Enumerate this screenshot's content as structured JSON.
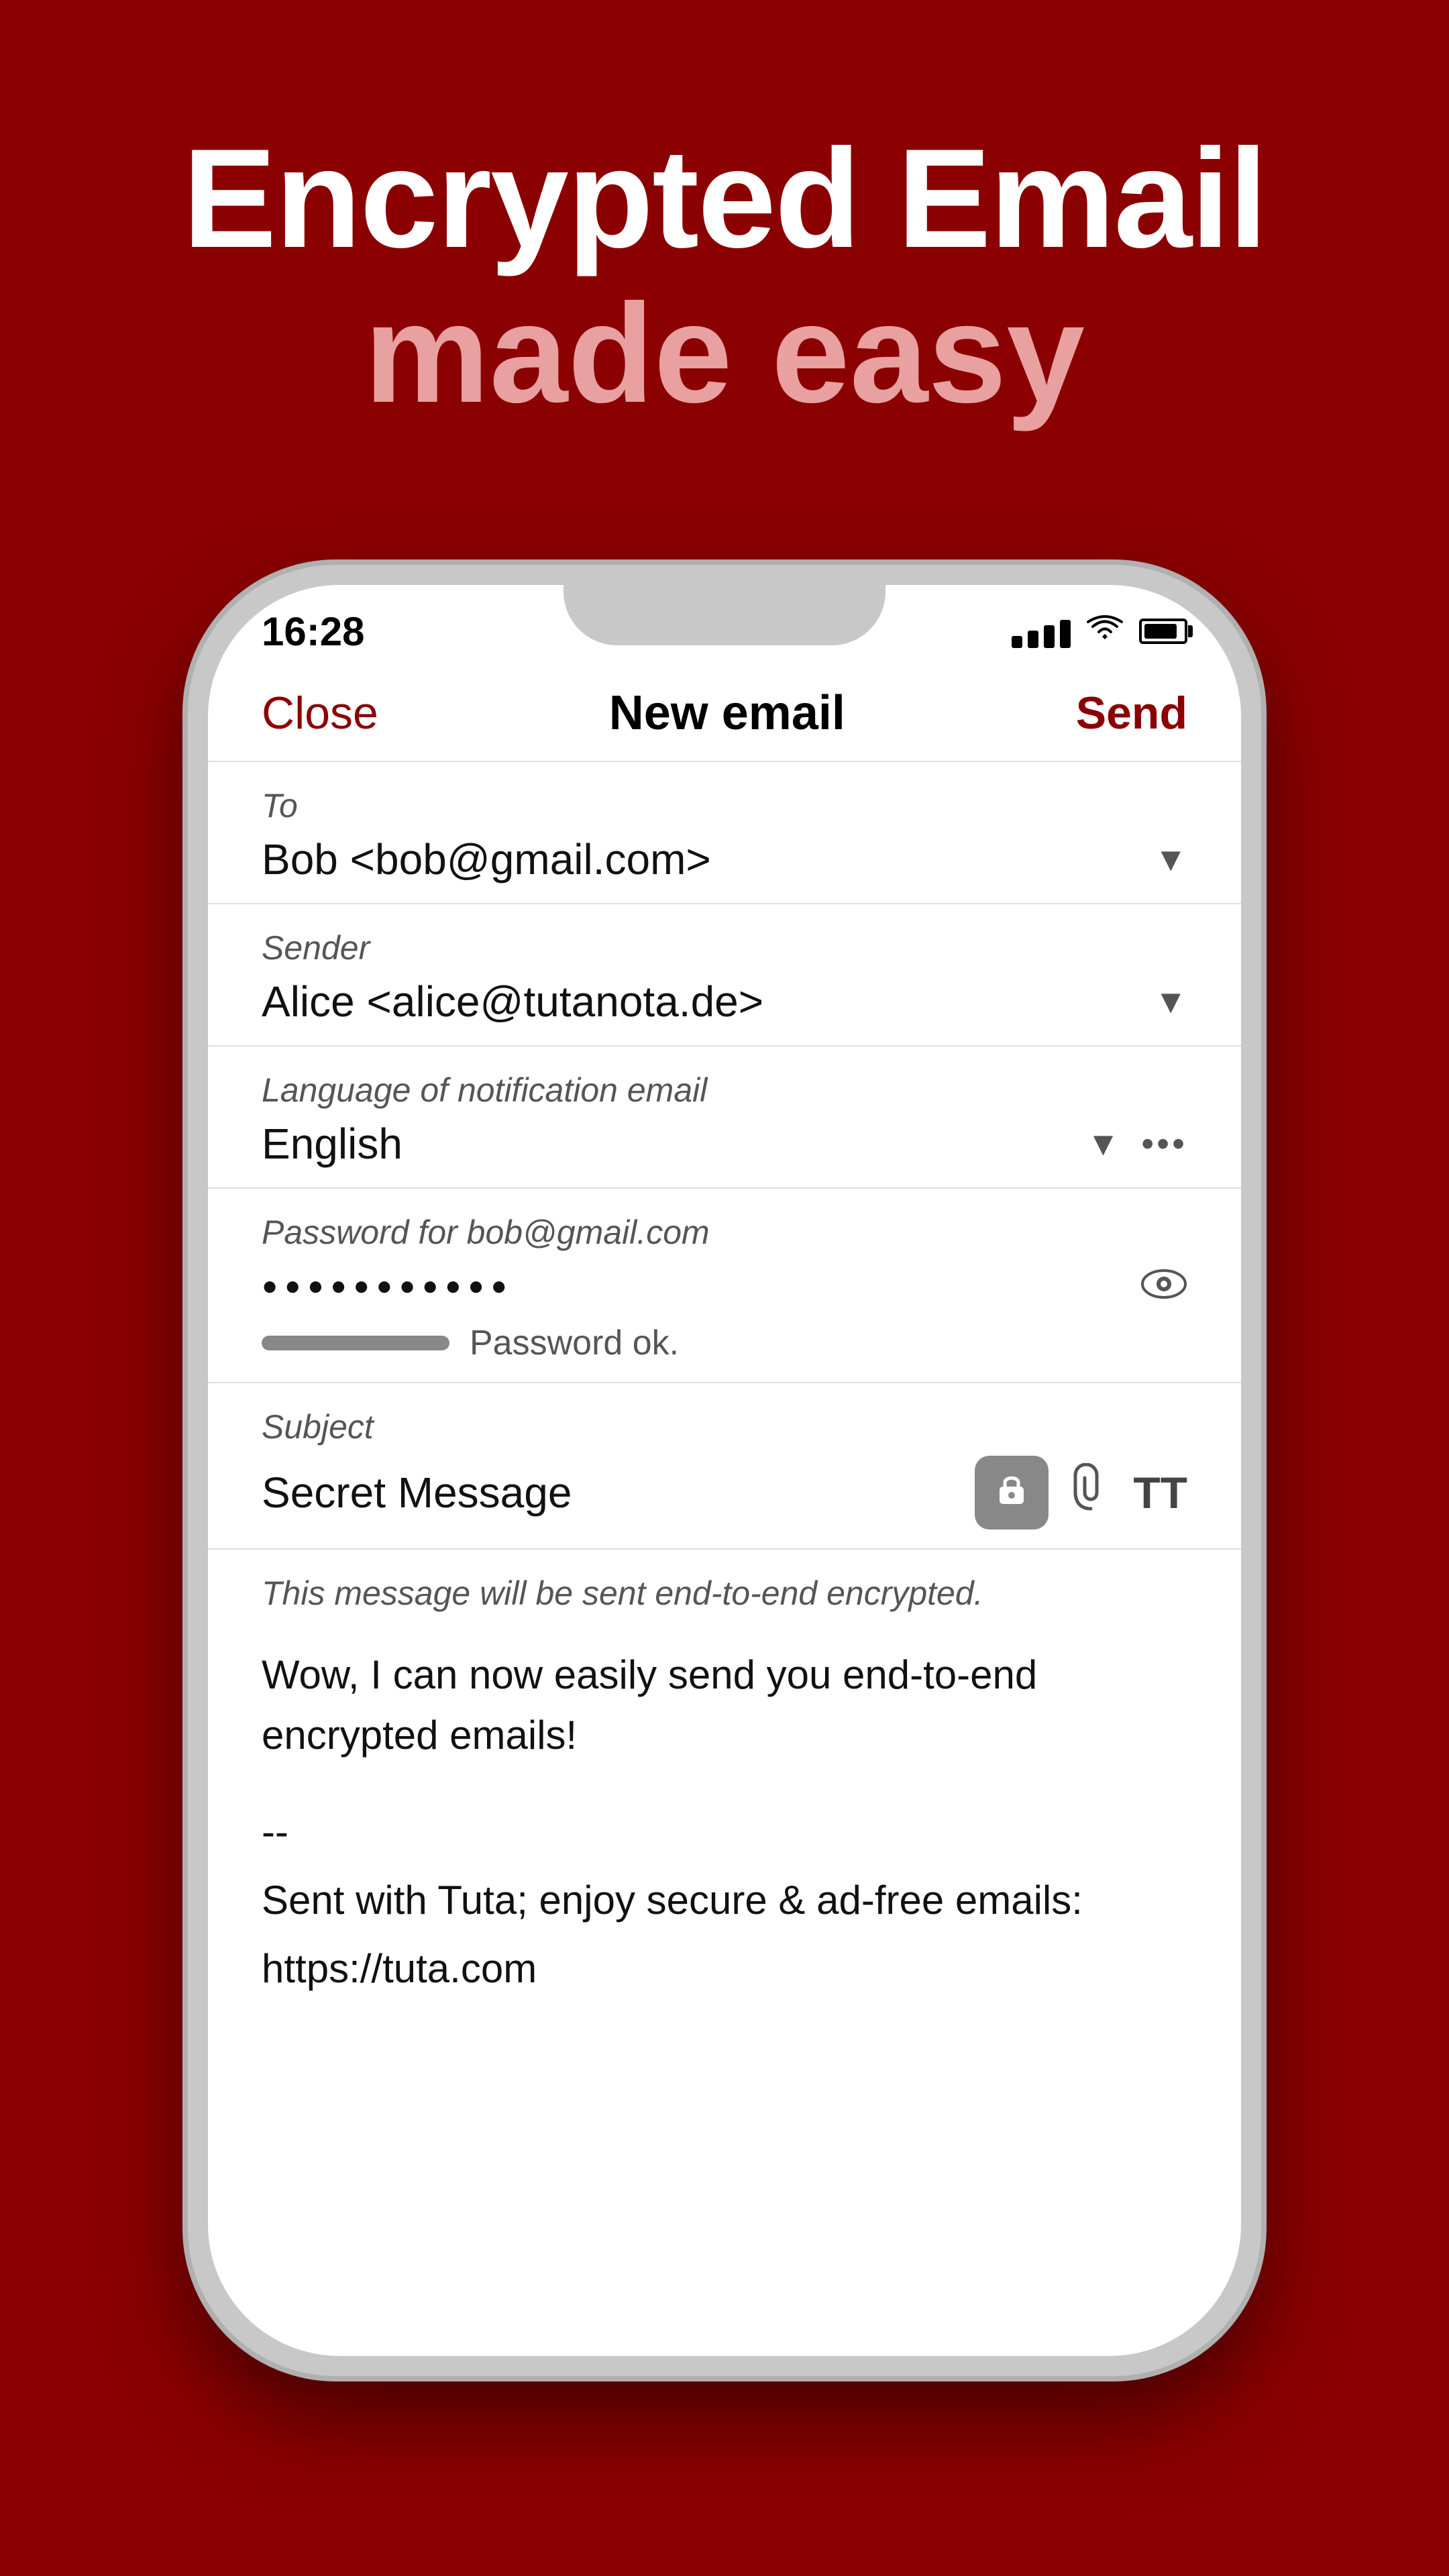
{
  "hero": {
    "line1": "Encrypted Email",
    "line2": "made easy"
  },
  "phone": {
    "status": {
      "time": "16:28"
    },
    "nav": {
      "close_label": "Close",
      "title": "New email",
      "send_label": "Send"
    },
    "fields": {
      "to_label": "To",
      "to_value": "Bob <bob@gmail.com>",
      "sender_label": "Sender",
      "sender_value": "Alice <alice@tutanota.de>",
      "notification_label": "Language of notification email",
      "notification_value": "English",
      "password_label": "Password for bob@gmail.com",
      "password_value": "●●●●●●●●●●●",
      "password_strength": "Password ok.",
      "subject_label": "Subject",
      "subject_value": "Secret Message",
      "encrypt_notice": "This message will be sent end-to-end encrypted.",
      "message_body": "Wow, I can now easily send you end-to-end encrypted emails!",
      "message_signature_line1": "--",
      "message_signature_line2": "Sent with Tuta; enjoy secure & ad-free emails:",
      "message_signature_line3": "https://tuta.com"
    }
  }
}
